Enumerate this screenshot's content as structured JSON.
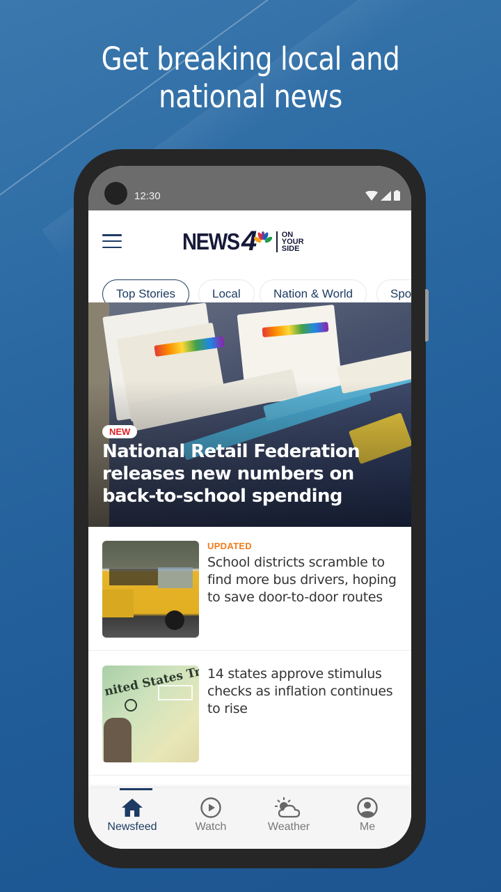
{
  "promo": {
    "headline_line1": "Get breaking local and",
    "headline_line2": "national news"
  },
  "statusbar": {
    "time": "12:30",
    "icons": [
      "wifi-icon",
      "signal-icon",
      "battery-icon"
    ]
  },
  "appbar": {
    "menu_icon": "hamburger-menu-icon",
    "logo_text": "NEWS",
    "logo_number": "4",
    "logo_tag_lines": [
      "ON",
      "YOUR",
      "SIDE"
    ]
  },
  "categories": [
    {
      "label": "Top Stories",
      "active": true
    },
    {
      "label": "Local",
      "active": false
    },
    {
      "label": "Nation & World",
      "active": false
    },
    {
      "label": "Sports",
      "visible_text": "Spo",
      "active": false
    }
  ],
  "hero": {
    "badge": "NEW",
    "title": "National Retail Federation releases new numbers on back-to-school spending",
    "image_description": "Packs of colorful markers and glue sticks"
  },
  "stories": [
    {
      "tag": "UPDATED",
      "title": "School districts scramble to find more bus drivers, hoping to save door-to-door routes",
      "image_description": "Yellow school buses"
    },
    {
      "tag": "",
      "title": "14 states approve stimulus checks as inflation continues to rise",
      "image_description": "United States Treasury check"
    }
  ],
  "bottom_nav": [
    {
      "label": "Newsfeed",
      "icon": "home-icon",
      "active": true
    },
    {
      "label": "Watch",
      "icon": "play-circle-icon",
      "active": false
    },
    {
      "label": "Weather",
      "icon": "partly-cloudy-icon",
      "active": false
    },
    {
      "label": "Me",
      "icon": "account-circle-icon",
      "active": false
    }
  ],
  "colors": {
    "brand_navy": "#1d3b63",
    "badge_red": "#e01f26",
    "updated_orange": "#f07c1c",
    "background_blue": "#2a68a2"
  }
}
